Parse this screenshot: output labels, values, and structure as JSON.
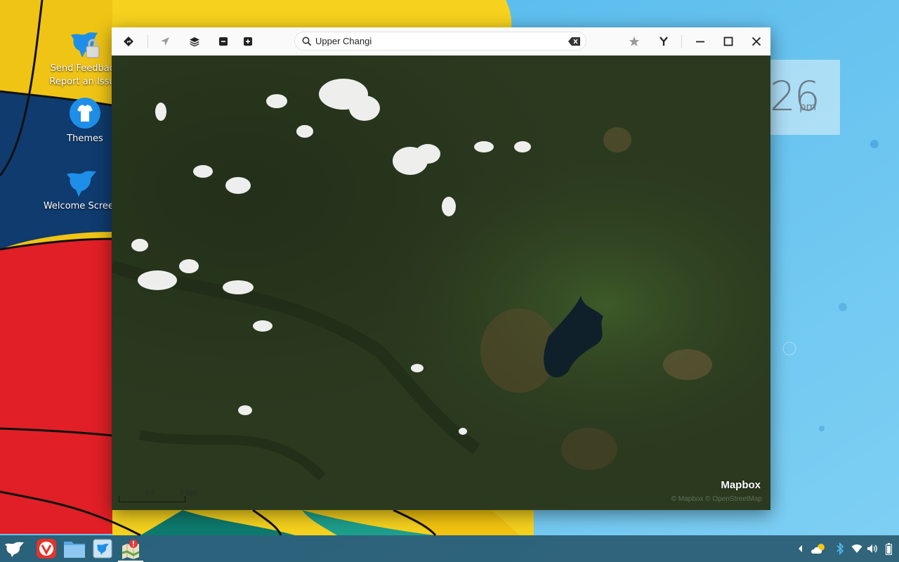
{
  "desktop": {
    "icons": [
      {
        "name": "send-feedback",
        "line1": "Send Feedback",
        "line2": "Report an Issue"
      },
      {
        "name": "themes",
        "label": "Themes"
      },
      {
        "name": "welcome-screen",
        "label": "Welcome Screen"
      }
    ],
    "clock": {
      "time_partial": "26",
      "ampm": "pm"
    }
  },
  "maps_window": {
    "toolbar": {
      "directions_icon": "directions-icon",
      "location_icon": "location-arrow-icon",
      "layers_icon": "layers-icon",
      "zoom_out_icon": "zoom-out-icon",
      "zoom_in_icon": "zoom-in-icon",
      "search": {
        "value": "Upper Changi",
        "clear_icon": "backspace-clear-icon"
      },
      "favorite_icon": "star-icon",
      "share_icon": "share-icon",
      "window_controls": [
        "minimize-icon",
        "maximize-icon",
        "close-icon"
      ]
    },
    "map": {
      "provider_logo": "Mapbox",
      "attribution": "© Mapbox © OpenStreetMap",
      "scale": {
        "mid": "3.5",
        "end": "7 km"
      }
    }
  },
  "taskbar": {
    "apps": [
      "app-launcher",
      "vivaldi-browser",
      "file-manager",
      "software-store",
      "maps"
    ],
    "tray": [
      "chevron-left-icon",
      "weather-icon",
      "bluetooth-icon",
      "wifi-icon",
      "volume-icon",
      "battery-icon"
    ]
  },
  "colors": {
    "sky": "#5fc0ee",
    "balloon_yellow": "#f5cf1c",
    "balloon_red": "#e01f26",
    "balloon_blue": "#0f3b6e",
    "map_green": "#2d3b20",
    "taskbar": "#143c4e",
    "maps_badge": "#e53935"
  }
}
